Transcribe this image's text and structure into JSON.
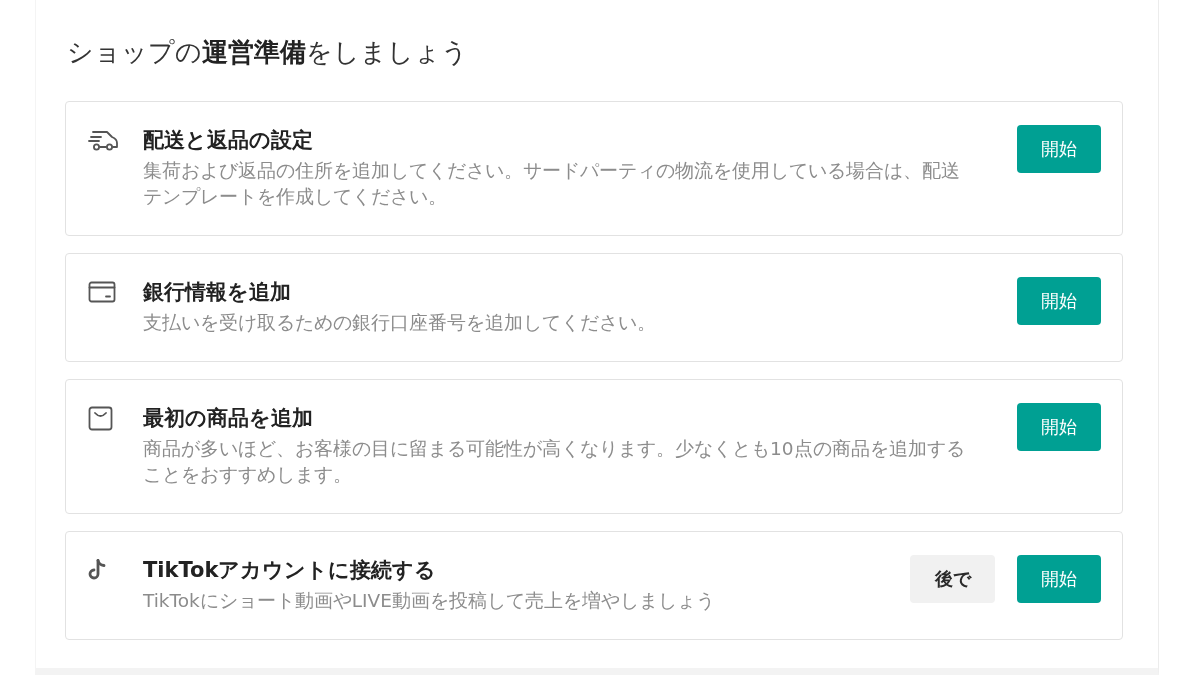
{
  "heading": "ショップの**運営準備**をしましょう",
  "tasks": [
    {
      "title": "配送と返品の設定",
      "description": "集荷および返品の住所を追加してください。サードパーティの物流を使用している場合は、配送テンプレートを作成してください。",
      "buttons": [
        {
          "kind": "primary",
          "label": "開始"
        }
      ]
    },
    {
      "title": "銀行情報を追加",
      "description": "支払いを受け取るための銀行口座番号を追加してください。",
      "buttons": [
        {
          "kind": "primary",
          "label": "開始"
        }
      ]
    },
    {
      "title": "最初の商品を追加",
      "description": "商品が多いほど、お客様の目に留まる可能性が高くなります。少なくとも10点の商品を追加することをおすすめします。",
      "buttons": [
        {
          "kind": "primary",
          "label": "開始"
        }
      ]
    },
    {
      "title": "TikTokアカウントに接続する",
      "description": "TikTokにショート動画やLIVE動画を投稿して売上を増やしましょう",
      "buttons": [
        {
          "kind": "secondary",
          "label": "後で"
        },
        {
          "kind": "primary",
          "label": "開始"
        }
      ]
    }
  ]
}
